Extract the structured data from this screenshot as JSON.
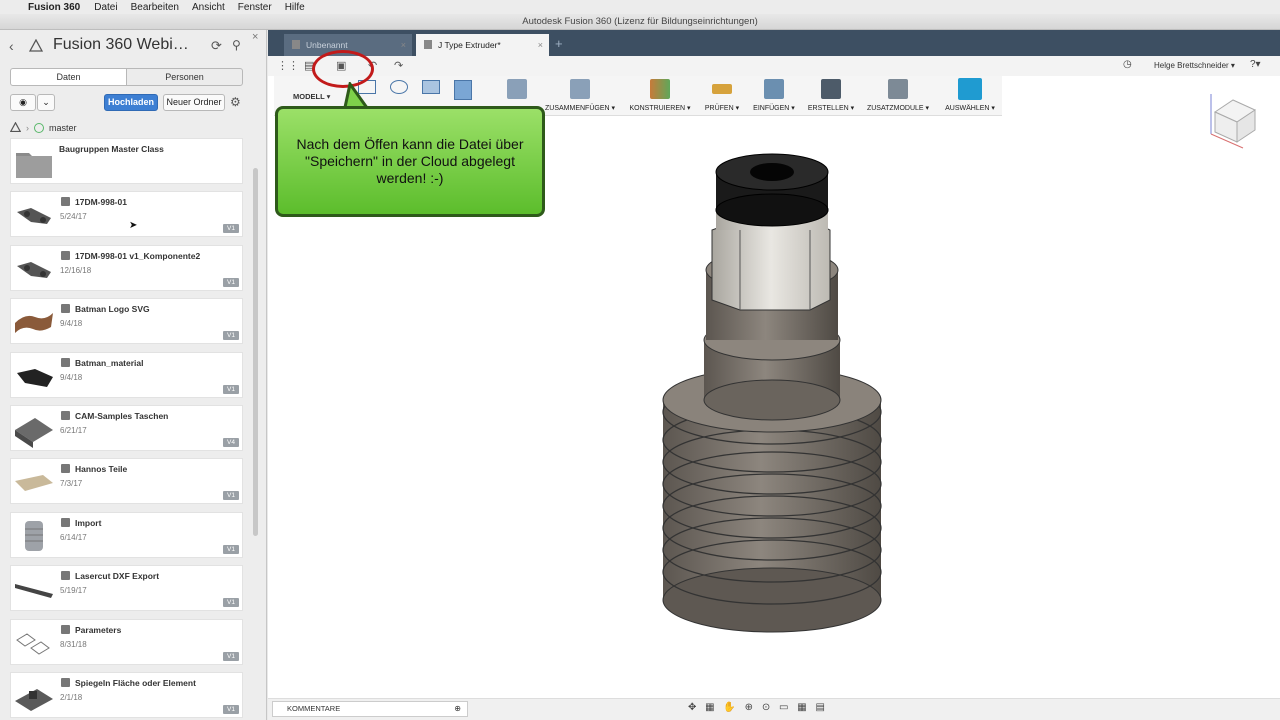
{
  "menubar": {
    "app_name": "Fusion 360",
    "items": [
      "Datei",
      "Bearbeiten",
      "Ansicht",
      "Fenster",
      "Hilfe"
    ]
  },
  "window": {
    "title": "Autodesk Fusion 360 (Lizenz für Bildungseinrichtungen)"
  },
  "panel": {
    "hub_title": "Fusion 360 Webi…",
    "tabs": [
      "Daten",
      "Personen"
    ],
    "upload_label": "Hochladen",
    "new_folder_label": "Neuer Ordner",
    "branch": "master",
    "items": [
      {
        "name": "Baugruppen Master Class",
        "date": "",
        "version": "",
        "kind": "folder"
      },
      {
        "name": "17DM-998-01",
        "date": "5/24/17",
        "version": "V1",
        "kind": "design"
      },
      {
        "name": "17DM-998-01 v1_Komponente2",
        "date": "12/16/18",
        "version": "V1",
        "kind": "design"
      },
      {
        "name": "Batman Logo SVG",
        "date": "9/4/18",
        "version": "V1",
        "kind": "design"
      },
      {
        "name": "Batman_material",
        "date": "9/4/18",
        "version": "V1",
        "kind": "design"
      },
      {
        "name": "CAM-Samples Taschen",
        "date": "6/21/17",
        "version": "V4",
        "kind": "design"
      },
      {
        "name": "Hannos Teile",
        "date": "7/3/17",
        "version": "V1",
        "kind": "design"
      },
      {
        "name": "Import",
        "date": "6/14/17",
        "version": "V1",
        "kind": "design"
      },
      {
        "name": "Lasercut DXF Export",
        "date": "5/19/17",
        "version": "V1",
        "kind": "design"
      },
      {
        "name": "Parameters",
        "date": "8/31/18",
        "version": "V1",
        "kind": "design"
      },
      {
        "name": "Spiegeln Fläche oder Element",
        "date": "2/1/18",
        "version": "V1",
        "kind": "design"
      }
    ]
  },
  "tabs": [
    {
      "label": "Unbenannt"
    },
    {
      "label": "J Type Extruder*"
    }
  ],
  "user": {
    "name": "Helge Brettschneider ▾",
    "help": "?▾"
  },
  "ribbon": {
    "mode": "MODELL ▾",
    "groups": [
      {
        "label": "ZUSAMMENFÜGEN ▾",
        "color": "#8aa0b8"
      },
      {
        "label": "KONSTRUIEREN ▾",
        "color": "#c77b3a"
      },
      {
        "label": "PRÜFEN ▾",
        "color": "#d6a23c"
      },
      {
        "label": "EINFÜGEN ▾",
        "color": "#6b8fb0"
      },
      {
        "label": "ERSTELLEN ▾",
        "color": "#4d5b69"
      },
      {
        "label": "ZUSATZMODULE ▾",
        "color": "#7d8a96"
      },
      {
        "label": "AUSWÄHLEN ▾",
        "color": "#1f9bd1"
      }
    ]
  },
  "callout": {
    "text": "Nach dem Öffen kann die Datei über \"Speichern\" in der Cloud abgelegt werden! :-)"
  },
  "bottom": {
    "comments_label": "KOMMENTARE"
  },
  "colors": {
    "accent": "#3d7fd3",
    "callout": "#7ed14a",
    "ring": "#c21a1a",
    "tabbar": "#3d4f62"
  }
}
